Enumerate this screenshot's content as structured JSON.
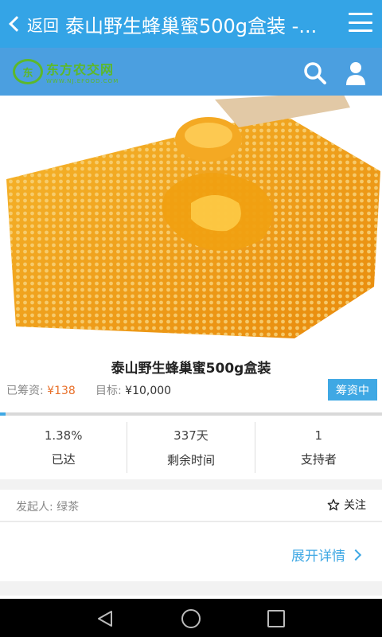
{
  "titlebar": {
    "back_label": "返回",
    "title": "泰山野生蜂巢蜜500g盒装 -..."
  },
  "brand": {
    "logo_text": "东方农交网",
    "logo_subtext": "WWW.NJ.EFOOD.COM",
    "logo_mark": "东"
  },
  "product": {
    "name": "泰山野生蜂巢蜜500g盒装",
    "raised_label": "已筹资: ",
    "raised_amount": "¥138",
    "goal_label": "目标: ",
    "goal_amount": "¥10,000",
    "status": "筹资中",
    "progress_fraction": 0.0138
  },
  "stats": [
    {
      "value": "1.38%",
      "label": "已达"
    },
    {
      "value": "337天",
      "label": "剩余时间"
    },
    {
      "value": "1",
      "label": "支持者"
    }
  ],
  "sponsor": {
    "label": "发起人: 绿茶",
    "follow_label": "关注"
  },
  "details": {
    "expand_label": "展开详情"
  },
  "colors": {
    "accent": "#34a4e6",
    "price": "#e8702a",
    "logo_green": "#5cb82b"
  }
}
